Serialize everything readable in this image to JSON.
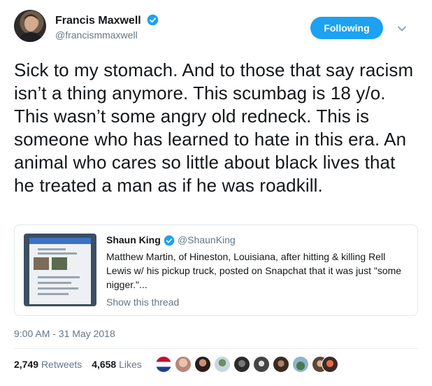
{
  "author": {
    "name": "Francis Maxwell",
    "handle": "@francismmaxwell",
    "follow_label": "Following"
  },
  "tweet": {
    "text": "Sick to my stomach. And to those that say racism isn’t a thing anymore. This scumbag is 18 y/o. This wasn’t some angry old redneck. This is someone who has learned to hate in this era. An animal who cares so little about black lives that he treated a man as if he was roadkill.",
    "timestamp": "9:00 AM - 31 May 2018",
    "retweets": "2,749",
    "retweets_label": "Retweets",
    "likes": "4,658",
    "likes_label": "Likes"
  },
  "quoted": {
    "name": "Shaun King",
    "handle": "@ShaunKing",
    "text": "Matthew Martin, of Hineston, Louisiana, after hitting & killing Rell Lewis w/ his pickup truck, posted on Snapchat that it was just \"some nigger.\"...",
    "thread_link": "Show this thread"
  },
  "colors": {
    "accent": "#1da1f2",
    "text": "#14171a",
    "secondary": "#657786"
  },
  "icons": {
    "verified": "verified-badge-icon",
    "caret": "chevron-down-icon"
  },
  "likers_count": 10
}
